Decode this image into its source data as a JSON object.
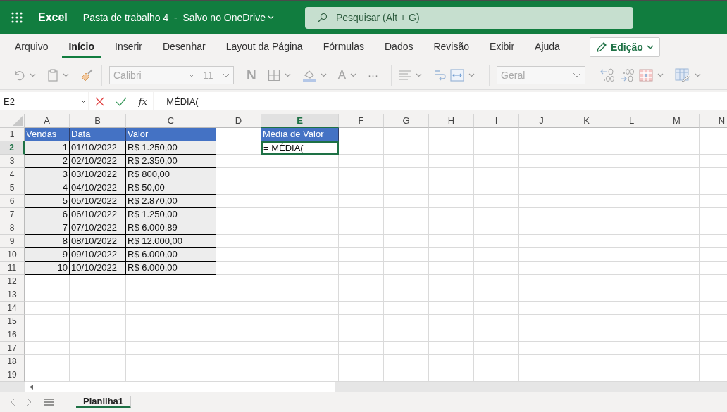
{
  "app": {
    "name": "Excel",
    "document": "Pasta de trabalho 4  -  Salvo no OneDrive"
  },
  "search": {
    "placeholder": "Pesquisar (Alt + G)"
  },
  "tabs": [
    {
      "label": "Arquivo",
      "selected": false
    },
    {
      "label": "Início",
      "selected": true
    },
    {
      "label": "Inserir",
      "selected": false
    },
    {
      "label": "Desenhar",
      "selected": false
    },
    {
      "label": "Layout da Página",
      "selected": false
    },
    {
      "label": "Fórmulas",
      "selected": false
    },
    {
      "label": "Dados",
      "selected": false
    },
    {
      "label": "Revisão",
      "selected": false
    },
    {
      "label": "Exibir",
      "selected": false
    },
    {
      "label": "Ajuda",
      "selected": false
    }
  ],
  "mode_button": {
    "label": "Edição"
  },
  "toolbar": {
    "font": "Calibri",
    "size": "11",
    "bold": "N",
    "font_color": "A",
    "more": "···",
    "number_format": "Geral"
  },
  "formula_bar": {
    "name_box": "E2",
    "fx": "fx",
    "formula": "= MÉDIA("
  },
  "columns": [
    {
      "label": "A",
      "selected": false
    },
    {
      "label": "B",
      "selected": false
    },
    {
      "label": "C",
      "selected": false
    },
    {
      "label": "D",
      "selected": false
    },
    {
      "label": "E",
      "selected": true
    },
    {
      "label": "F",
      "selected": false
    },
    {
      "label": "G",
      "selected": false
    },
    {
      "label": "H",
      "selected": false
    },
    {
      "label": "I",
      "selected": false
    },
    {
      "label": "J",
      "selected": false
    },
    {
      "label": "K",
      "selected": false
    },
    {
      "label": "L",
      "selected": false
    },
    {
      "label": "M",
      "selected": false
    },
    {
      "label": "N",
      "selected": false
    }
  ],
  "rows": [
    {
      "label": "1",
      "selected": false
    },
    {
      "label": "2",
      "selected": true
    },
    {
      "label": "3",
      "selected": false
    },
    {
      "label": "4",
      "selected": false
    },
    {
      "label": "5",
      "selected": false
    },
    {
      "label": "6",
      "selected": false
    },
    {
      "label": "7",
      "selected": false
    },
    {
      "label": "8",
      "selected": false
    },
    {
      "label": "9",
      "selected": false
    },
    {
      "label": "10",
      "selected": false
    },
    {
      "label": "11",
      "selected": false
    },
    {
      "label": "12",
      "selected": false
    },
    {
      "label": "13",
      "selected": false
    },
    {
      "label": "14",
      "selected": false
    },
    {
      "label": "15",
      "selected": false
    },
    {
      "label": "16",
      "selected": false
    },
    {
      "label": "17",
      "selected": false
    },
    {
      "label": "18",
      "selected": false
    },
    {
      "label": "19",
      "selected": false
    }
  ],
  "table": {
    "header": [
      "Vendas",
      "Data",
      "Valor"
    ],
    "rows": [
      [
        "1",
        "01/10/2022",
        "R$ 1.250,00"
      ],
      [
        "2",
        "02/10/2022",
        "R$ 2.350,00"
      ],
      [
        "3",
        "03/10/2022",
        "R$ 800,00"
      ],
      [
        "4",
        "04/10/2022",
        "R$ 50,00"
      ],
      [
        "5",
        "05/10/2022",
        "R$ 2.870,00"
      ],
      [
        "6",
        "06/10/2022",
        "R$ 1.250,00"
      ],
      [
        "7",
        "07/10/2022",
        "R$ 6.000,89"
      ],
      [
        "8",
        "08/10/2022",
        "R$ 12.000,00"
      ],
      [
        "9",
        "09/10/2022",
        "R$ 6.000,00"
      ],
      [
        "10",
        "10/10/2022",
        "R$ 6.000,00"
      ]
    ]
  },
  "average": {
    "header": "Média de Valor",
    "editing": "= MÉDIA("
  },
  "sheets": [
    {
      "name": "Planilha1",
      "selected": true
    }
  ]
}
